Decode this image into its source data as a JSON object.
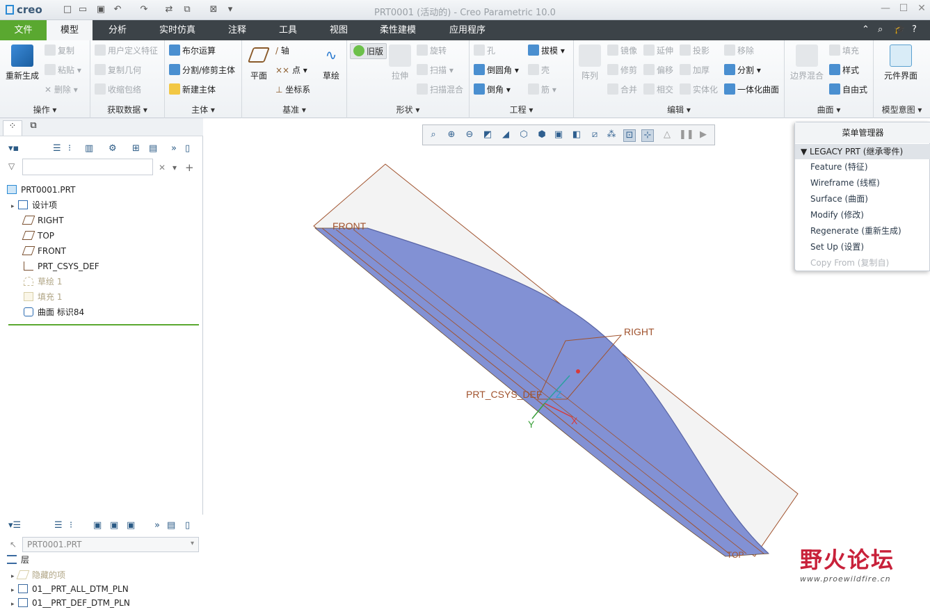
{
  "window": {
    "logo": "creo",
    "title": "PRT0001 (活动的) - Creo Parametric 10.0"
  },
  "tabs": [
    "文件",
    "模型",
    "分析",
    "实时仿真",
    "注释",
    "工具",
    "视图",
    "柔性建模",
    "应用程序"
  ],
  "ribbon": {
    "operations": {
      "label": "操作",
      "regenerate": "重新生成",
      "copy": "复制",
      "paste": "粘贴",
      "delete": "删除"
    },
    "get_data": {
      "label": "获取数据",
      "udf": "用户定义特征",
      "copy_geom": "复制几何",
      "shrinkwrap": "收缩包络"
    },
    "body": {
      "label": "主体",
      "boolean": "布尔运算",
      "split": "分割/修剪主体",
      "new_body": "新建主体"
    },
    "datum": {
      "label": "基准",
      "plane": "平面",
      "axis": "轴",
      "point": "点",
      "csys": "坐标系",
      "sketch": "草绘"
    },
    "shapes": {
      "label": "形状",
      "legacy": "旧版",
      "extrude": "拉伸",
      "revolve": "旋转",
      "sweep": "扫描",
      "swept_blend": "扫描混合"
    },
    "engineering": {
      "label": "工程",
      "hole": "孔",
      "round": "倒圆角",
      "chamfer": "倒角",
      "draft": "拔模",
      "shell": "壳",
      "rib": "筋"
    },
    "editing": {
      "label": "编辑",
      "pattern": "阵列",
      "mirror": "镜像",
      "extend": "延伸",
      "project": "投影",
      "trim": "修剪",
      "offset": "偏移",
      "thicken": "加厚",
      "merge": "合并",
      "intersect": "相交",
      "solidify": "实体化",
      "remove": "移除",
      "split": "分割",
      "unify": "一体化曲面"
    },
    "surfaces": {
      "label": "曲面",
      "boundary": "边界混合",
      "fill": "填充",
      "style": "样式",
      "freestyle": "自由式"
    },
    "model_intent": {
      "label": "模型意图",
      "component_interface": "元件界面"
    }
  },
  "model_tree": {
    "items": [
      {
        "label": "PRT0001.PRT",
        "state": "normal"
      },
      {
        "label": "设计项",
        "state": "normal"
      },
      {
        "label": "RIGHT",
        "state": "normal"
      },
      {
        "label": "TOP",
        "state": "normal"
      },
      {
        "label": "FRONT",
        "state": "normal"
      },
      {
        "label": "PRT_CSYS_DEF",
        "state": "normal"
      },
      {
        "label": "草绘 1",
        "state": "suppressed"
      },
      {
        "label": "填充 1",
        "state": "suppressed"
      },
      {
        "label": "曲面 标识84",
        "state": "normal"
      }
    ]
  },
  "layers": {
    "selector_value": "PRT0001.PRT",
    "root": "层",
    "items": [
      "隐藏的项",
      "01__PRT_ALL_DTM_PLN",
      "01__PRT_DEF_DTM_PLN"
    ]
  },
  "menu_manager": {
    "title": "菜单管理器",
    "header": "LEGACY PRT (继承零件)",
    "items": [
      {
        "label": "Feature (特征)",
        "enabled": true
      },
      {
        "label": "Wireframe (线框)",
        "enabled": true
      },
      {
        "label": "Surface (曲面)",
        "enabled": true
      },
      {
        "label": "Modify (修改)",
        "enabled": true
      },
      {
        "label": "Regenerate (重新生成)",
        "enabled": true
      },
      {
        "label": "Set Up (设置)",
        "enabled": true
      },
      {
        "label": "Copy From (复制自)",
        "enabled": false
      }
    ]
  },
  "graphics": {
    "labels": {
      "front": "FRONT",
      "right": "RIGHT",
      "top": "TOP",
      "csys": "PRT_CSYS_DEF",
      "x": "X",
      "y": "Y",
      "z": "Z"
    },
    "surface_color": "#7f8fd0",
    "datum_color": "#a0522d"
  },
  "watermark": {
    "title": "野火论坛",
    "url": "www.proewildfire.cn"
  }
}
